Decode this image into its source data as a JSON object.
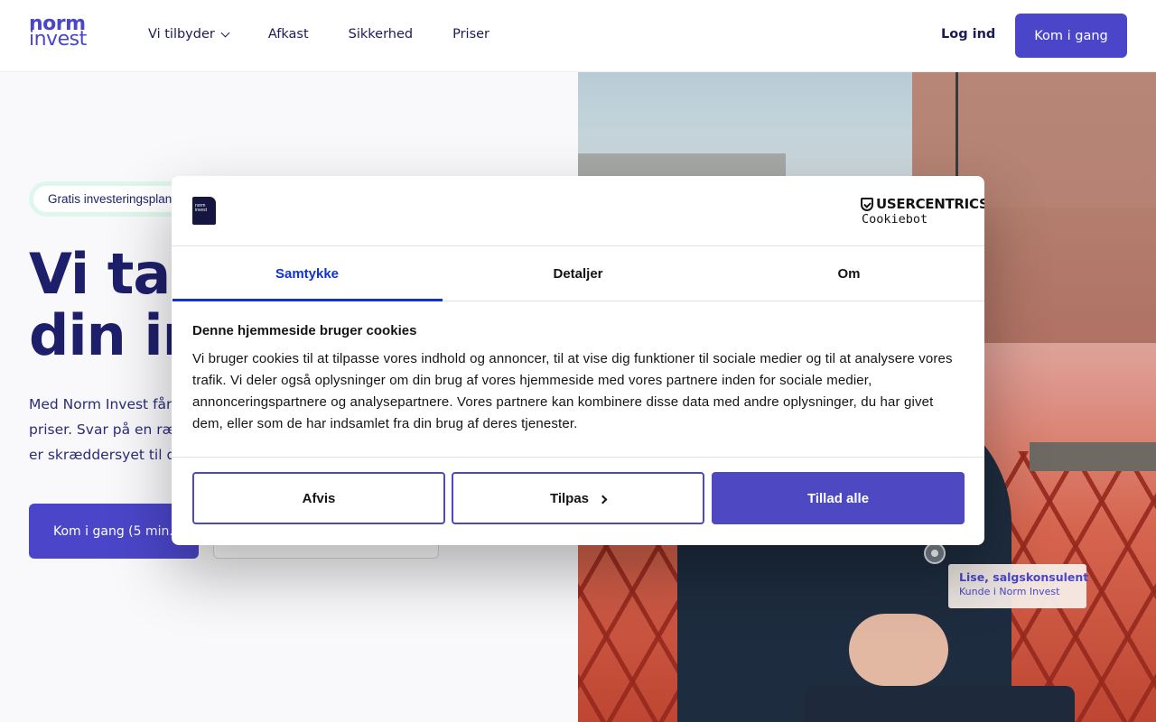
{
  "header": {
    "logo_line1": "norm",
    "logo_line2": "invest",
    "nav": [
      {
        "label": "Vi tilbyder",
        "has_dropdown": true
      },
      {
        "label": "Afkast"
      },
      {
        "label": "Sikkerhed"
      },
      {
        "label": "Priser"
      }
    ],
    "login_label": "Log ind",
    "cta_label": "Kom i gang"
  },
  "hero": {
    "badge": "Gratis investeringsplan",
    "headline_line1": "Vi tag",
    "headline_line2": "din inv",
    "lead_line1": "Med  Norm Invest får d",
    "lead_line2": "priser. Svar på en ræk",
    "lead_line3": "er skræddersyet til dig",
    "cta_label": "Kom i gang  (5 min.)",
    "caption_name": "Lise, salgskonsulent",
    "caption_role": "Kunde i Norm Invest"
  },
  "cookie_dialog": {
    "logo_text": "norm invest",
    "provider_line1": "USERCENTRICS",
    "provider_line2": "Cookiebot",
    "tabs": [
      {
        "label": "Samtykke",
        "active": true
      },
      {
        "label": "Detaljer",
        "active": false
      },
      {
        "label": "Om",
        "active": false
      }
    ],
    "heading": "Denne hjemmeside bruger cookies",
    "body": "Vi bruger cookies til at tilpasse vores indhold og annoncer, til at vise dig funktioner til sociale medier og til at analysere vores trafik. Vi deler også oplysninger om din brug af vores hjemmeside med vores partnere inden for sociale medier, annonceringspartnere og analysepartnere. Vores partnere kan kombinere disse data med andre oplysninger, du har givet dem, eller som de har indsamlet fra din brug af deres tjenester.",
    "buttons": {
      "decline": "Afvis",
      "customize": "Tilpas",
      "allow_all": "Tillad alle"
    }
  },
  "colors": {
    "brand": "#4b46c9",
    "navy": "#1e1f6b",
    "tab_active": "#1032cf",
    "badge_border": "#def7ec"
  }
}
